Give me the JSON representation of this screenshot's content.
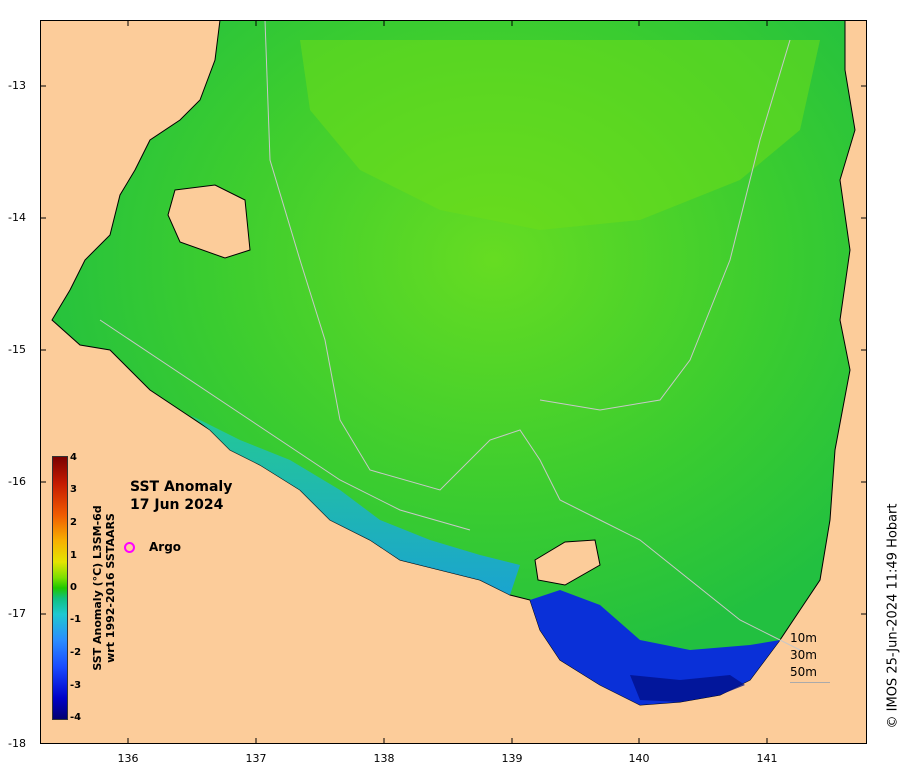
{
  "title": {
    "line1": "SST Anomaly",
    "line2": "17 Jun 2024"
  },
  "legend": {
    "argo_label": "Argo",
    "argo_color": "#ff00ff"
  },
  "colorbar": {
    "title_line1": "SST Anomaly (°C) L3SM-6d",
    "title_line2": "wrt 1992-2016 SSTAARS",
    "ticks": [
      "4",
      "3",
      "2",
      "1",
      "0",
      "-1",
      "-2",
      "-3",
      "-4"
    ],
    "range": [
      -4,
      4
    ]
  },
  "axes": {
    "y_ticks": [
      "-13",
      "-14",
      "-15",
      "-16",
      "-17",
      "-18"
    ],
    "x_ticks": [
      "136",
      "137",
      "138",
      "139",
      "140",
      "141"
    ],
    "lon_range": [
      135.3,
      141.8
    ],
    "lat_range": [
      -12.5,
      -18
    ]
  },
  "depth_legend": {
    "d1": "10m",
    "d2": "30m",
    "d3": "50m"
  },
  "credit": "© IMOS 25-Jun-2024 11:49 Hobart",
  "colors": {
    "land": "#fccc9a",
    "ocean": "#36c83c",
    "warm_patch": "#6edc1a",
    "cool_coast": "#1aa8d8",
    "cold_coast": "#0a30d8"
  }
}
